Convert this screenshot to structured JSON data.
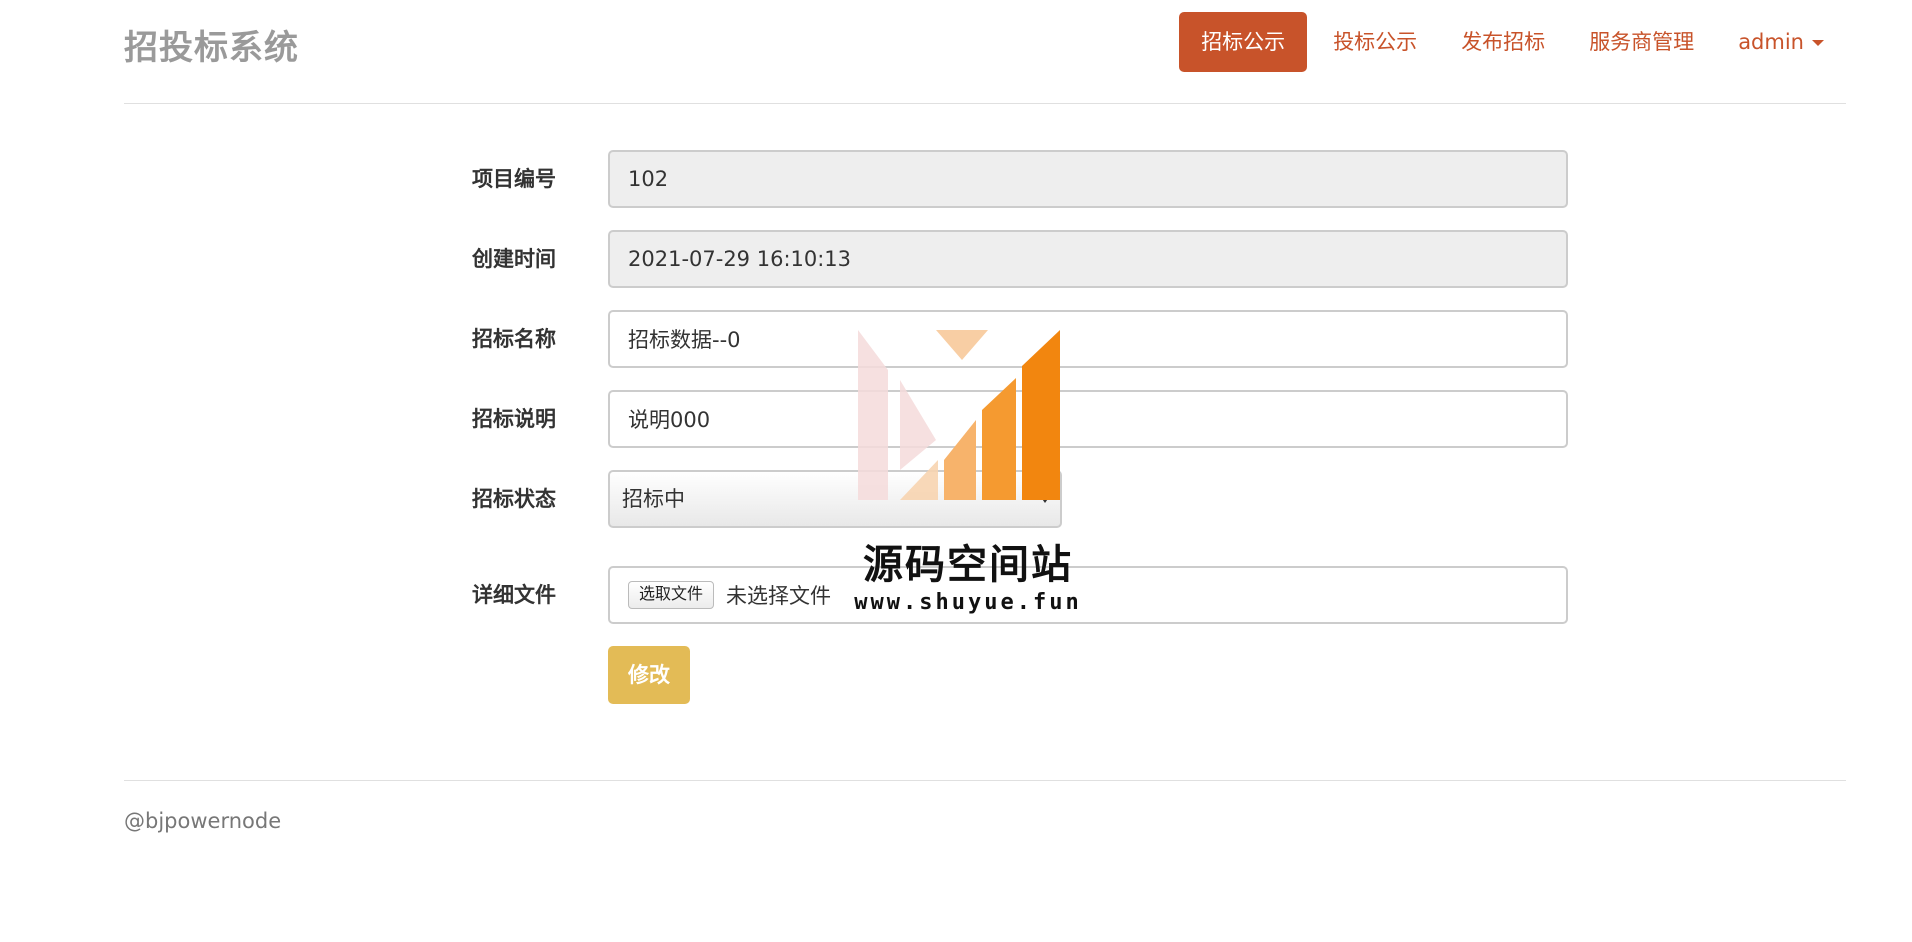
{
  "header": {
    "brand": "招投标系统",
    "nav": [
      {
        "label": "招标公示",
        "active": true
      },
      {
        "label": "投标公示",
        "active": false
      },
      {
        "label": "发布招标",
        "active": false
      },
      {
        "label": "服务商管理",
        "active": false
      },
      {
        "label": "admin",
        "active": false
      }
    ]
  },
  "form": {
    "project_no": {
      "label": "项目编号",
      "value": "102"
    },
    "created_at": {
      "label": "创建时间",
      "value": "2021-07-29 16:10:13"
    },
    "tender_name": {
      "label": "招标名称",
      "value": "招标数据--0"
    },
    "tender_desc": {
      "label": "招标说明",
      "value": "说明000"
    },
    "tender_status": {
      "label": "招标状态",
      "value": "招标中"
    },
    "detail_file": {
      "label": "详细文件",
      "button": "选取文件",
      "status": "未选择文件"
    },
    "submit_label": "修改"
  },
  "watermark": {
    "title": "源码空间站",
    "url": "www.shuyue.fun"
  },
  "footer": {
    "text": "@bjpowernode"
  },
  "colors": {
    "accent": "#c8532a",
    "submit": "#e3bb56",
    "brand_text": "#9a9a9a"
  }
}
